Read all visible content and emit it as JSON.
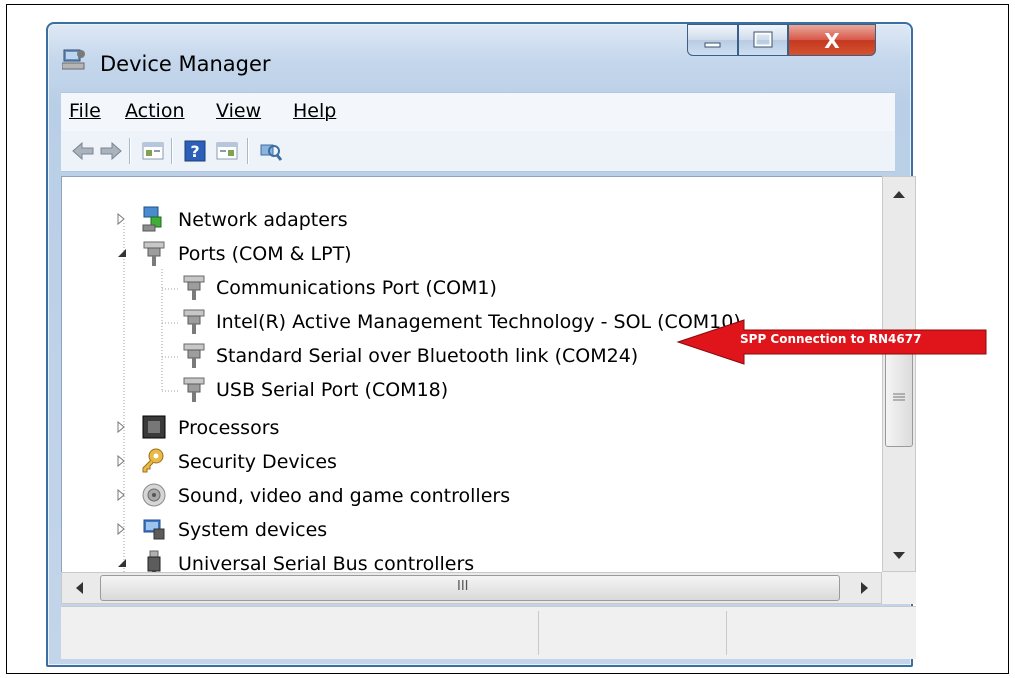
{
  "window": {
    "title": "Device Manager"
  },
  "title_buttons": {
    "minimize_icon": "minimize-icon",
    "maximize_icon": "maximize-icon",
    "close_glyph": "X"
  },
  "menu": [
    {
      "label": "File"
    },
    {
      "label": "Action"
    },
    {
      "label": "View"
    },
    {
      "label": "Help"
    }
  ],
  "toolbar": [
    "back-arrow-icon",
    "forward-arrow-icon",
    "properties-icon",
    "help-icon",
    "properties-panel-icon",
    "scan-hardware-icon"
  ],
  "tree": {
    "items": [
      {
        "label": "Network adapters",
        "icon": "network-adapter-icon",
        "expanded": false,
        "level": 0
      },
      {
        "label": "Ports (COM & LPT)",
        "icon": "port-icon",
        "expanded": true,
        "level": 0
      },
      {
        "label": "Communications Port (COM1)",
        "icon": "port-icon",
        "level": 1
      },
      {
        "label": "Intel(R) Active Management Technology - SOL (COM10)",
        "icon": "port-icon",
        "level": 1
      },
      {
        "label": "Standard Serial over Bluetooth link (COM24)",
        "icon": "port-icon",
        "level": 1
      },
      {
        "label": "USB Serial Port (COM18)",
        "icon": "port-icon",
        "level": 1
      },
      {
        "label": "Processors",
        "icon": "processor-icon",
        "expanded": false,
        "level": 0
      },
      {
        "label": "Security Devices",
        "icon": "key-icon",
        "expanded": false,
        "level": 0
      },
      {
        "label": "Sound, video and game controllers",
        "icon": "speaker-icon",
        "expanded": false,
        "level": 0
      },
      {
        "label": "System devices",
        "icon": "computer-icon",
        "expanded": false,
        "level": 0
      },
      {
        "label": "Universal Serial Bus controllers",
        "icon": "usb-icon",
        "expanded": true,
        "level": 0
      }
    ]
  },
  "scrollbar": {
    "h_thumb_grip": "III"
  },
  "annotation": {
    "text": "SPP Connection to RN4677",
    "color": "#e0141b"
  },
  "colors": {
    "window_border": "#3a6fa0",
    "close_button": "#c4381f"
  }
}
